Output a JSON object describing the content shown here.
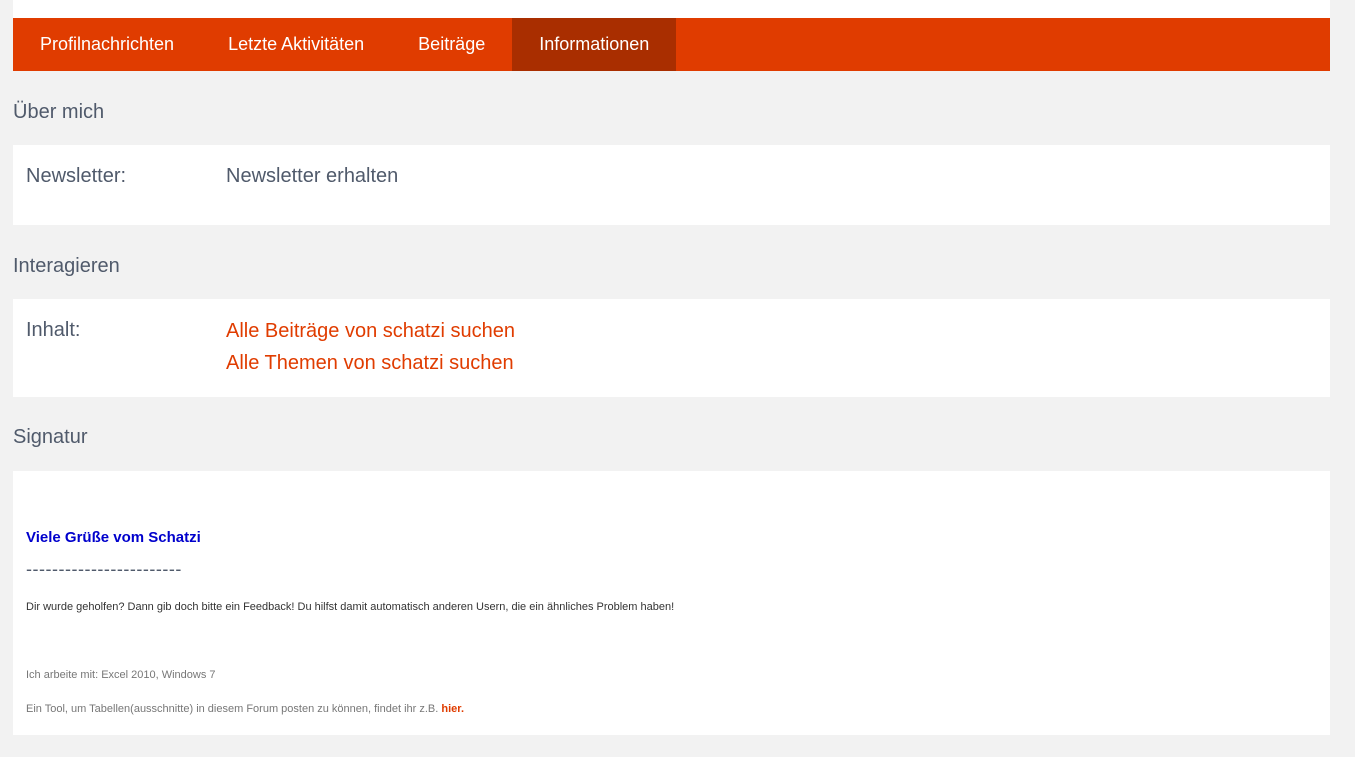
{
  "tabs": [
    {
      "label": "Profilnachrichten"
    },
    {
      "label": "Letzte Aktivitäten"
    },
    {
      "label": "Beiträge"
    },
    {
      "label": "Informationen"
    }
  ],
  "about": {
    "title": "Über mich",
    "newsletter_label": "Newsletter:",
    "newsletter_value": "Newsletter erhalten"
  },
  "interact": {
    "title": "Interagieren",
    "content_label": "Inhalt:",
    "links": [
      "Alle Beiträge von schatzi suchen",
      "Alle Themen von schatzi suchen"
    ]
  },
  "signature": {
    "title": "Signatur",
    "greeting": "Viele Grüße vom Schatzi",
    "dashes": "------------------------",
    "feedback": "Dir wurde geholfen? Dann gib doch bitte ein Feedback! Du hilfst damit automatisch anderen Usern, die ein ähnliches Problem haben!",
    "setup": "Ich arbeite mit: Excel 2010, Windows 7",
    "tool_text": "Ein Tool, um Tabellen(ausschnitte) in diesem Forum posten zu können, findet ihr z.B. ",
    "tool_link": "hier."
  },
  "colors": {
    "accent": "#e03c00",
    "tab_active": "#a92e00",
    "greeting": "#0000cc"
  }
}
